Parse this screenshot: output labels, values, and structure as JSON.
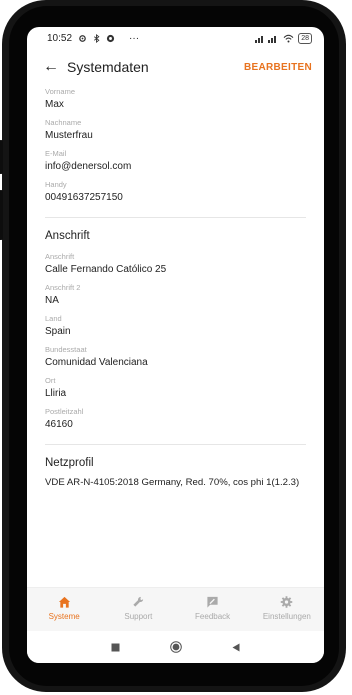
{
  "status_bar": {
    "time": "10:52",
    "left_icons": [
      "settings-icon",
      "bluetooth-icon",
      "chrome-icon"
    ],
    "more": "···",
    "battery": "28"
  },
  "app_bar": {
    "title": "Systemdaten",
    "edit_label": "BEARBEITEN"
  },
  "personal": [
    {
      "label": "Vorname",
      "value": "Max"
    },
    {
      "label": "Nachname",
      "value": "Musterfrau"
    },
    {
      "label": "E-Mail",
      "value": "info@denersol.com"
    },
    {
      "label": "Handy",
      "value": "00491637257150"
    }
  ],
  "address": {
    "heading": "Anschrift",
    "fields": [
      {
        "label": "Anschrift",
        "value": "Calle Fernando Católico 25"
      },
      {
        "label": "Anschrift 2",
        "value": "NA"
      },
      {
        "label": "Land",
        "value": "Spain"
      },
      {
        "label": "Bundesstaat",
        "value": "Comunidad Valenciana"
      },
      {
        "label": "Ort",
        "value": "Lliria"
      },
      {
        "label": "Postleitzahl",
        "value": "46160"
      }
    ]
  },
  "grid_profile": {
    "heading": "Netzprofil",
    "value": "VDE AR-N-4105:2018 Germany, Red. 70%, cos phi 1(1.2.3)"
  },
  "bottom_nav": [
    {
      "label": "Systeme",
      "icon": "home-icon",
      "active": true
    },
    {
      "label": "Support",
      "icon": "wrench-icon",
      "active": false
    },
    {
      "label": "Feedback",
      "icon": "feedback-icon",
      "active": false
    },
    {
      "label": "Einstellungen",
      "icon": "gear-icon",
      "active": false
    }
  ],
  "colors": {
    "accent": "#e8731f",
    "inactive": "#aaaaaa"
  }
}
